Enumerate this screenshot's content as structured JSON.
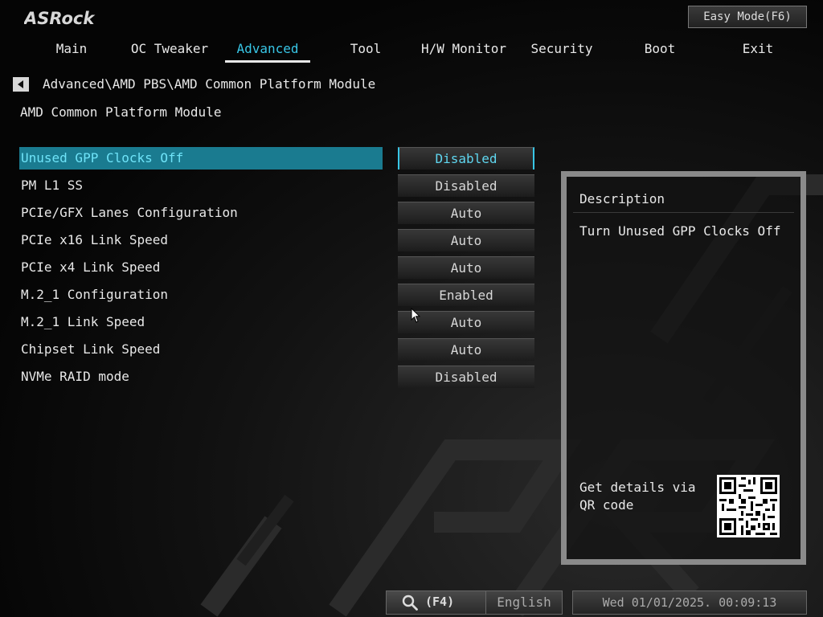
{
  "brand": {
    "logo_text": "ASRock"
  },
  "header": {
    "easy_mode_label": "Easy Mode(F6)"
  },
  "tabs": [
    {
      "label": "Main",
      "active": false
    },
    {
      "label": "OC Tweaker",
      "active": false
    },
    {
      "label": "Advanced",
      "active": true
    },
    {
      "label": "Tool",
      "active": false
    },
    {
      "label": "H/W Monitor",
      "active": false
    },
    {
      "label": "Security",
      "active": false
    },
    {
      "label": "Boot",
      "active": false
    },
    {
      "label": "Exit",
      "active": false
    }
  ],
  "breadcrumb": "Advanced\\AMD PBS\\AMD Common Platform Module",
  "page_title": "AMD Common Platform Module",
  "settings": [
    {
      "label": "Unused GPP Clocks Off",
      "value": "Disabled",
      "selected": true
    },
    {
      "label": "PM L1 SS",
      "value": "Disabled",
      "selected": false
    },
    {
      "label": "PCIe/GFX Lanes Configuration",
      "value": "Auto",
      "selected": false
    },
    {
      "label": "PCIe x16 Link Speed",
      "value": "Auto",
      "selected": false
    },
    {
      "label": "PCIe x4 Link Speed",
      "value": "Auto",
      "selected": false
    },
    {
      "label": "M.2_1 Configuration",
      "value": "Enabled",
      "selected": false
    },
    {
      "label": "M.2_1 Link Speed",
      "value": "Auto",
      "selected": false
    },
    {
      "label": "Chipset Link Speed",
      "value": "Auto",
      "selected": false
    },
    {
      "label": "NVMe RAID mode",
      "value": "Disabled",
      "selected": false
    }
  ],
  "description": {
    "title": "Description",
    "text": "Turn Unused GPP Clocks Off",
    "qr_caption": "Get details via QR code"
  },
  "footer": {
    "search_key": "(F4)",
    "language": "English",
    "datetime": "Wed 01/01/2025. 00:09:13"
  },
  "colors": {
    "accent": "#38c6e6",
    "selected_row": "#1a7b90",
    "panel_border": "#8a8a8a"
  },
  "icons": [
    "back-arrow-icon",
    "search-icon",
    "mouse-cursor-icon",
    "qr-code-icon"
  ]
}
